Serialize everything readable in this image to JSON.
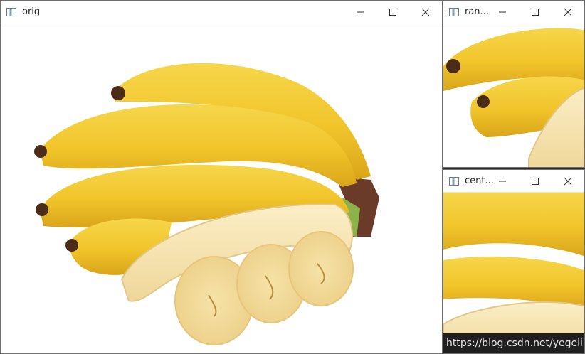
{
  "windows": {
    "orig": {
      "title": "orig"
    },
    "random": {
      "title": "ran..."
    },
    "center": {
      "title": "cent..."
    }
  },
  "icons": {
    "minimize": "minimize-icon",
    "maximize": "maximize-icon",
    "close": "close-icon"
  },
  "watermark": "https://blog.csdn.net/yegeli"
}
